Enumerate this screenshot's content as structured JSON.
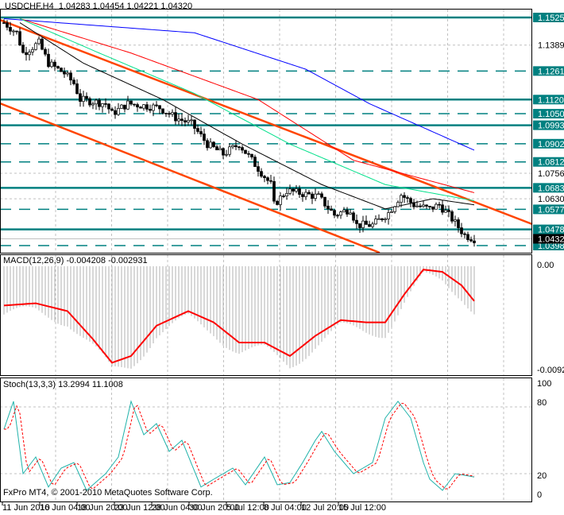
{
  "header": {
    "symbol": "USDCHF,H4",
    "ohlc": "1.04283 1.04454 1.04221 1.04320"
  },
  "price_axis": {
    "plain": [
      "1.13895",
      "1.07560",
      "1.06300"
    ],
    "levels_solid": [
      "1.15258",
      "1.11201",
      "1.09932",
      "1.06839",
      "1.04787"
    ],
    "levels_dashed": [
      "1.12613",
      "1.10503",
      "1.09020",
      "1.08121",
      "1.05776",
      "1.03986"
    ],
    "current": "1.04320"
  },
  "macd": {
    "title": "MACD(12,26,9) -0.004208 -0.002931",
    "top": "0.00",
    "bottom": "-0.00928"
  },
  "stoch": {
    "title": "Stoch(13,3,3) 13.2994 11.1008",
    "ticks": [
      "100",
      "80",
      "20",
      "0"
    ]
  },
  "copyright": "FxPro MT4, © 2001-2010 MetaQuotes Software Corp.",
  "time_axis": [
    "11 Jun 2010",
    "16 Jun 04:00",
    "18 Jun 20:00",
    "23 Jun 12:00",
    "28 Jun 04:00",
    "30 Jun 20:00",
    "5 Jul 12:00",
    "8 Jul 04:00",
    "12 Jul 20:00",
    "15 Jul 12:00"
  ],
  "colors": {
    "level": "#008080",
    "trend": "#ff4500",
    "macd_signal": "#ff0000",
    "stoch_main": "#20b2aa",
    "stoch_signal": "#ff0000"
  },
  "price_path": [
    [
      0,
      1.15
    ],
    [
      4,
      1.145
    ],
    [
      6,
      1.135
    ],
    [
      11,
      1.14
    ],
    [
      14,
      1.13
    ],
    [
      19,
      1.125
    ],
    [
      22,
      1.12
    ],
    [
      24,
      1.112
    ],
    [
      32,
      1.11
    ],
    [
      34,
      1.105
    ],
    [
      39,
      1.11
    ],
    [
      49,
      1.108
    ],
    [
      54,
      1.103
    ],
    [
      59,
      1.1
    ],
    [
      64,
      1.09
    ],
    [
      69,
      1.085
    ],
    [
      74,
      1.09
    ],
    [
      79,
      1.08
    ],
    [
      84,
      1.07
    ],
    [
      85,
      1.06
    ],
    [
      89,
      1.067
    ],
    [
      99,
      1.064
    ],
    [
      104,
      1.055
    ],
    [
      109,
      1.058
    ],
    [
      111,
      1.05
    ],
    [
      116,
      1.05
    ],
    [
      121,
      1.056
    ],
    [
      125,
      1.065
    ],
    [
      129,
      1.06
    ],
    [
      134,
      1.058
    ],
    [
      137,
      1.06
    ],
    [
      141,
      1.053
    ],
    [
      145,
      1.045
    ],
    [
      148,
      1.0432
    ]
  ],
  "ma_blue": [
    [
      0,
      1.152
    ],
    [
      60,
      1.145
    ],
    [
      95,
      1.127
    ],
    [
      115,
      1.11
    ],
    [
      148,
      1.087
    ]
  ],
  "ma_red": [
    [
      5,
      1.152
    ],
    [
      40,
      1.135
    ],
    [
      80,
      1.112
    ],
    [
      110,
      1.082
    ],
    [
      148,
      1.066
    ]
  ],
  "ma_green": [
    [
      5,
      1.152
    ],
    [
      30,
      1.135
    ],
    [
      60,
      1.115
    ],
    [
      90,
      1.09
    ],
    [
      120,
      1.07
    ],
    [
      148,
      1.062
    ]
  ],
  "ma_black": [
    [
      5,
      1.15
    ],
    [
      25,
      1.13
    ],
    [
      50,
      1.112
    ],
    [
      75,
      1.09
    ],
    [
      100,
      1.07
    ],
    [
      120,
      1.058
    ],
    [
      135,
      1.063
    ],
    [
      148,
      1.06
    ]
  ],
  "macd_signal": [
    [
      0,
      -0.0035
    ],
    [
      10,
      -0.0033
    ],
    [
      20,
      -0.004
    ],
    [
      28,
      -0.0065
    ],
    [
      34,
      -0.0086
    ],
    [
      40,
      -0.008
    ],
    [
      48,
      -0.0053
    ],
    [
      58,
      -0.004
    ],
    [
      66,
      -0.005
    ],
    [
      74,
      -0.0068
    ],
    [
      82,
      -0.0068
    ],
    [
      90,
      -0.008
    ],
    [
      98,
      -0.0062
    ],
    [
      106,
      -0.0048
    ],
    [
      114,
      -0.005
    ],
    [
      120,
      -0.005
    ],
    [
      126,
      -0.0025
    ],
    [
      132,
      -0.0003
    ],
    [
      138,
      -0.0005
    ],
    [
      144,
      -0.0017
    ],
    [
      148,
      -0.0031
    ]
  ],
  "stoch_main": [
    [
      0,
      60
    ],
    [
      3,
      85
    ],
    [
      6,
      20
    ],
    [
      10,
      35
    ],
    [
      14,
      8
    ],
    [
      18,
      25
    ],
    [
      22,
      30
    ],
    [
      26,
      5
    ],
    [
      32,
      20
    ],
    [
      36,
      35
    ],
    [
      40,
      85
    ],
    [
      44,
      55
    ],
    [
      48,
      65
    ],
    [
      52,
      40
    ],
    [
      56,
      50
    ],
    [
      62,
      8
    ],
    [
      66,
      15
    ],
    [
      72,
      25
    ],
    [
      76,
      10
    ],
    [
      82,
      35
    ],
    [
      86,
      10
    ],
    [
      90,
      12
    ],
    [
      94,
      30
    ],
    [
      98,
      50
    ],
    [
      100,
      58
    ],
    [
      104,
      40
    ],
    [
      110,
      20
    ],
    [
      116,
      30
    ],
    [
      120,
      70
    ],
    [
      124,
      85
    ],
    [
      128,
      70
    ],
    [
      132,
      30
    ],
    [
      134,
      15
    ],
    [
      138,
      5
    ],
    [
      142,
      20
    ],
    [
      146,
      18
    ],
    [
      148,
      17
    ]
  ]
}
